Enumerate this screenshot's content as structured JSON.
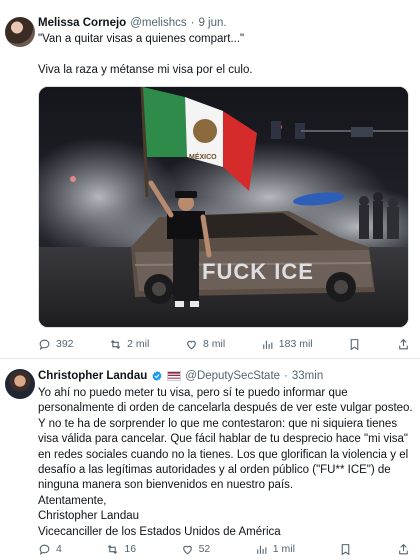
{
  "tweets": [
    {
      "author_name": "Melissa Cornejo",
      "handle": "@melishcs",
      "separator": "·",
      "time": "9 jun.",
      "text": "\"Van a quitar visas a quienes compart...\"\n\nViva la raza y métanse mi visa por el culo.",
      "graffiti_text": "FUCK ICE",
      "flag_text": "MÉXICO",
      "actions": {
        "replies": "392",
        "reposts": "2 mil",
        "likes": "8 mil",
        "views": "183 mil"
      }
    },
    {
      "author_name": "Christopher Landau",
      "handle": "@DeputySecState",
      "separator": "·",
      "time": "33min",
      "text": "Yo ahí no puedo meter tu visa, pero sí te puedo informar que personalmente di orden de cancelarla después de ver este vulgar posteo. Y no te ha de sorprender lo que me contestaron: que ni siquiera tienes visa válida para cancelar. Que fácil hablar de tu desprecio hace \"mi visa\" en redes sociales cuando no la tienes. Los que glorifican la violencia y el desafío a las legítimas autoridades y al orden público (\"FU** ICE\") de ninguna manera son bienvenidos en nuestro país.\nAtentamente,\nChristopher Landau\nVicecanciller de los Estados Unidos de América",
      "actions": {
        "replies": "4",
        "reposts": "16",
        "likes": "52",
        "views": "1 mil"
      }
    }
  ],
  "colors": {
    "text": "#0f1419",
    "muted": "#536471",
    "verified": "#1d9bf0",
    "divider": "#e6e9eb"
  }
}
